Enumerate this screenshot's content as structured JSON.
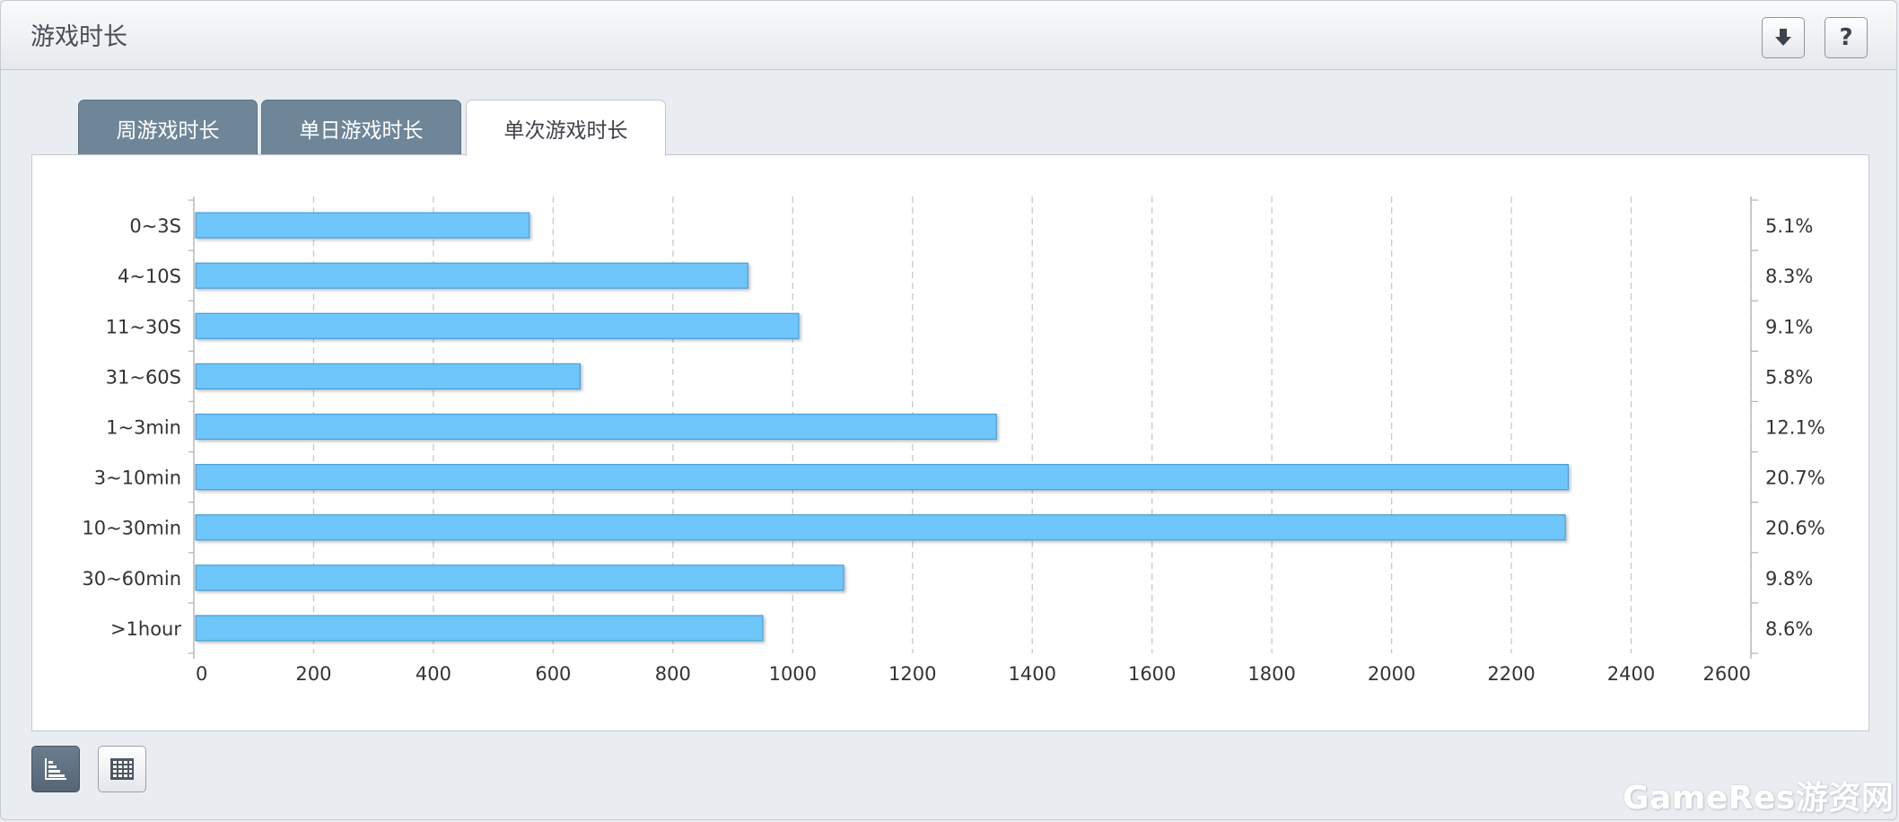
{
  "header": {
    "title": "游戏时长"
  },
  "tabs": [
    {
      "label": "周游戏时长",
      "active": false
    },
    {
      "label": "单日游戏时长",
      "active": false
    },
    {
      "label": "单次游戏时长",
      "active": true
    }
  ],
  "icons": {
    "download": "download-icon",
    "help": "?",
    "chart_view": "bar-chart-icon",
    "table_view": "table-icon"
  },
  "colors": {
    "bar_fill": "#6ec6fb",
    "bar_stroke": "#4c9ed8",
    "tab_inactive": "#6f8699"
  },
  "chart_data": {
    "type": "bar",
    "orientation": "horizontal",
    "categories": [
      "0~3S",
      "4~10S",
      "11~30S",
      "31~60S",
      "1~3min",
      "3~10min",
      "10~30min",
      "30~60min",
      ">1hour"
    ],
    "values": [
      560,
      925,
      1010,
      645,
      1340,
      2295,
      2290,
      1085,
      950
    ],
    "percent_labels": [
      "5.1%",
      "8.3%",
      "9.1%",
      "5.8%",
      "12.1%",
      "20.7%",
      "20.6%",
      "9.8%",
      "8.6%"
    ],
    "xlim": [
      0,
      2600
    ],
    "xticks": [
      0,
      200,
      400,
      600,
      800,
      1000,
      1200,
      1400,
      1600,
      1800,
      2000,
      2200,
      2400,
      2600
    ],
    "grid": "vertical-dashed",
    "legend": "none"
  },
  "watermark": "GameRes游资网"
}
